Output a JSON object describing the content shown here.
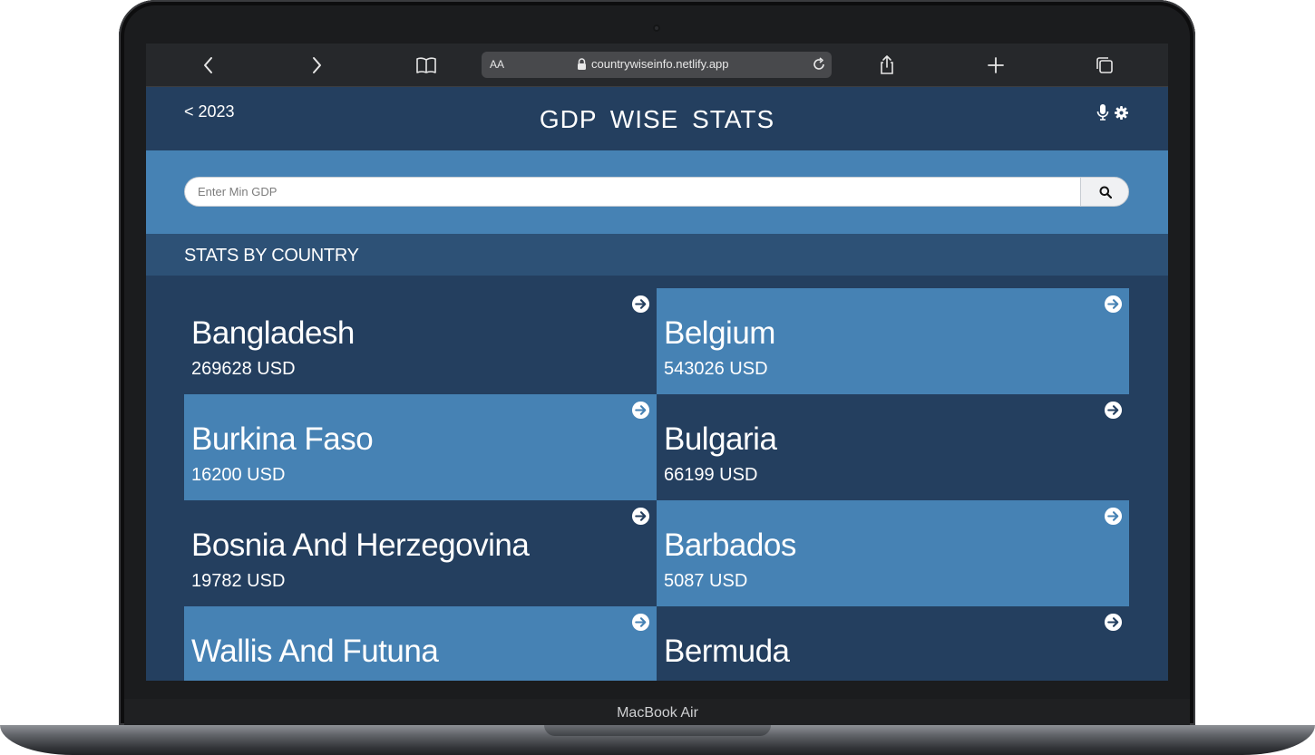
{
  "device": {
    "label": "MacBook Air"
  },
  "browser": {
    "address_aa": "AA",
    "url": "countrywiseinfo.netlify.app"
  },
  "header": {
    "back_label": "< 2023",
    "title": "GDP WISE STATS"
  },
  "search": {
    "placeholder": "Enter Min GDP"
  },
  "section": {
    "title": "STATS BY COUNTRY"
  },
  "countries": [
    {
      "name": "Bangladesh",
      "gdp": "269628 USD"
    },
    {
      "name": "Belgium",
      "gdp": "543026 USD"
    },
    {
      "name": "Burkina Faso",
      "gdp": "16200 USD"
    },
    {
      "name": "Bulgaria",
      "gdp": "66199 USD"
    },
    {
      "name": "Bosnia And Herzegovina",
      "gdp": "19782 USD"
    },
    {
      "name": "Barbados",
      "gdp": "5087 USD"
    },
    {
      "name": "Wallis And Futuna",
      "gdp": ""
    },
    {
      "name": "Bermuda",
      "gdp": ""
    }
  ],
  "colors": {
    "header_bg": "#243f5f",
    "search_band": "#4682b4",
    "section_head": "#2d5176",
    "card_dark": "#243f5f",
    "card_light": "#4682b4"
  }
}
